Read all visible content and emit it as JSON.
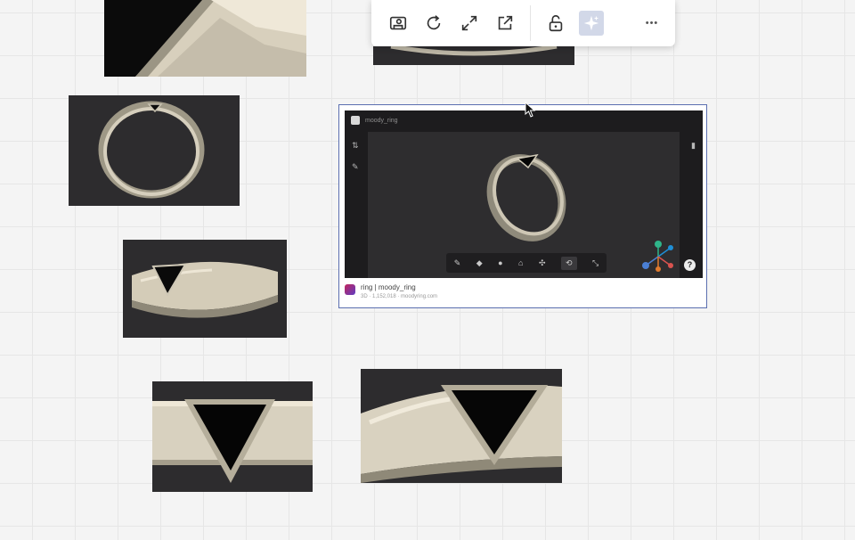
{
  "toolbar": {
    "buttons": [
      {
        "name": "embed-icon",
        "tool": "embed"
      },
      {
        "name": "refresh-icon",
        "tool": "refresh"
      },
      {
        "name": "expand-icon",
        "tool": "expand"
      },
      {
        "name": "open-external-icon",
        "tool": "open-external"
      },
      {
        "name": "unlock-icon",
        "tool": "lock"
      },
      {
        "name": "sparkle-icon",
        "tool": "ai",
        "active": true
      },
      {
        "name": "more-icon",
        "tool": "more"
      }
    ],
    "more_label": "•••"
  },
  "embed": {
    "viewer_title": "moody_ring",
    "name": "ring | moody_ring",
    "subtitle": "3D · 1,152,018 · moodyring.com",
    "help_label": "?",
    "toolbar_glyphs": [
      "✎",
      "◆",
      "●",
      "⌂",
      "✣",
      "⟲",
      "⤡"
    ],
    "side_glyphs": [
      "⇅",
      "✎"
    ],
    "comment_glyph": "▮"
  },
  "colors": {
    "accent_border": "#5b6fb0",
    "canvas": "#f4f4f4",
    "render_bg": "#2d2c2e",
    "metal": "#c9c3b2",
    "stone": "#0d0d0d"
  }
}
